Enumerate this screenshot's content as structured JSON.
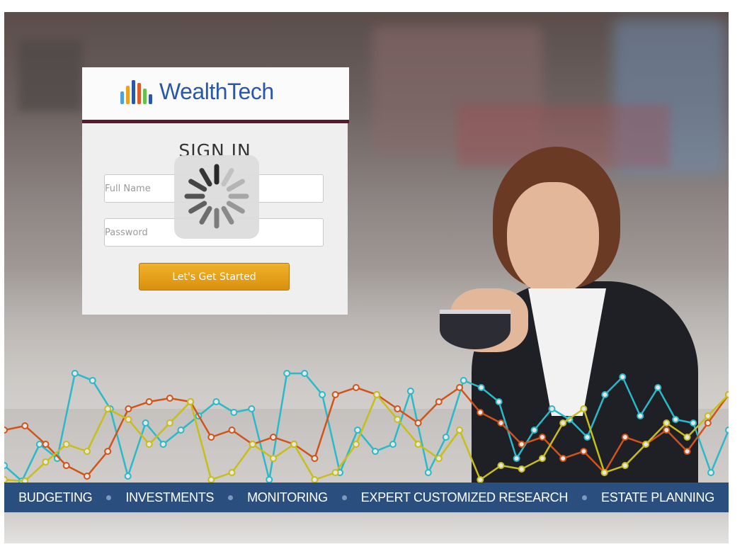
{
  "brand": {
    "name": "WealthTech",
    "logo_bars": [
      "#4aa3df",
      "#f0a020",
      "#2a58a8",
      "#e05a2a",
      "#6bc04a",
      "#2a58a8"
    ]
  },
  "signin": {
    "title": "SIGN IN",
    "name_placeholder": "Full Name",
    "password_placeholder": "Password",
    "submit_label": "Let's Get Started"
  },
  "loading_spinner": {
    "visible": true
  },
  "nav": {
    "items": [
      "BUDGETING",
      "INVESTMENTS",
      "MONITORING",
      "EXPERT CUSTOMIZED RESEARCH",
      "ESTATE PLANNING"
    ]
  },
  "colors": {
    "nav_bg": "#2a4f7f",
    "button": "#e3a01c",
    "logo_text": "#2a58a8",
    "series_cyan": "#2ab9c9",
    "series_orange": "#d0541a",
    "series_olive": "#c7be1a"
  },
  "chart_data": {
    "type": "line",
    "series": [
      {
        "values": [
          30,
          8,
          60,
          40,
          160,
          150,
          110,
          15,
          90,
          60,
          80,
          100,
          120,
          105,
          110,
          10,
          160,
          160,
          130,
          20,
          80,
          50,
          60,
          135,
          20,
          70,
          150,
          140,
          120,
          40,
          80,
          110,
          95,
          70,
          130,
          155,
          100,
          140,
          95,
          90,
          20,
          80
        ]
      },
      {
        "values": [
          80,
          86,
          60,
          30,
          15,
          50,
          110,
          120,
          125,
          120,
          70,
          80,
          60,
          70,
          60,
          40,
          130,
          140,
          130,
          110,
          90,
          120,
          140,
          105,
          90,
          60,
          70,
          40,
          50,
          20,
          70,
          60,
          80,
          50,
          90,
          130
        ]
      },
      {
        "values": [
          10,
          8,
          35,
          60,
          50,
          110,
          95,
          60,
          90,
          120,
          10,
          20,
          60,
          40,
          60,
          10,
          20,
          60,
          130,
          95,
          60,
          40,
          80,
          10,
          30,
          25,
          40,
          90,
          110,
          20,
          30,
          60,
          90,
          70,
          100,
          130
        ]
      }
    ]
  }
}
